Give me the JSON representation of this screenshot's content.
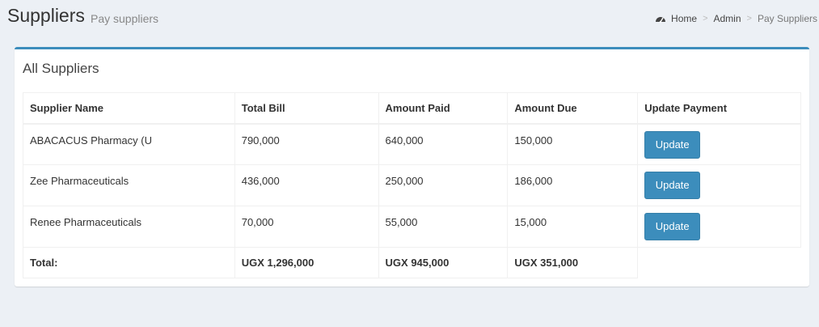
{
  "header": {
    "title": "Suppliers",
    "subtitle": "Pay suppliers"
  },
  "breadcrumb": {
    "icon": "dashboard-icon",
    "items": [
      "Home",
      "Admin",
      "Pay Suppliers"
    ]
  },
  "box": {
    "title": "All Suppliers"
  },
  "table": {
    "headers": [
      "Supplier Name",
      "Total Bill",
      "Amount Paid",
      "Amount Due",
      "Update Payment"
    ],
    "rows": [
      {
        "name": "ABACACUS Pharmacy (U",
        "total": "790,000",
        "paid": "640,000",
        "due": "150,000",
        "action": "Update"
      },
      {
        "name": "Zee Pharmaceuticals",
        "total": "436,000",
        "paid": "250,000",
        "due": "186,000",
        "action": "Update"
      },
      {
        "name": "Renee Pharmaceuticals",
        "total": "70,000",
        "paid": "55,000",
        "due": "15,000",
        "action": "Update"
      }
    ],
    "footer": {
      "label": "Total:",
      "total": "UGX 1,296,000",
      "paid": "UGX 945,000",
      "due": "UGX 351,000"
    }
  },
  "colors": {
    "accent": "#3c8dbc",
    "background": "#ecf0f5"
  }
}
